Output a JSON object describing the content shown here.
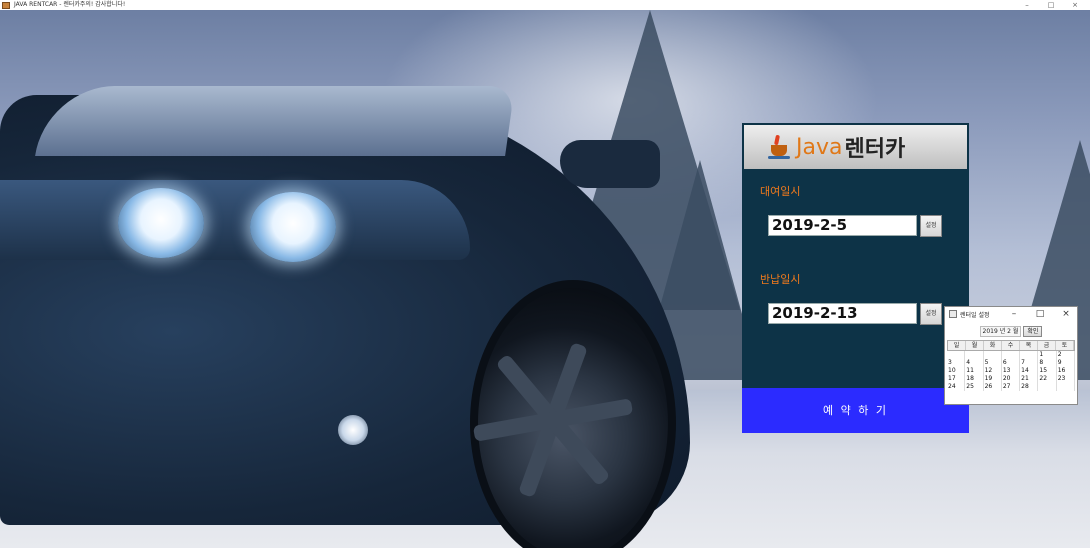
{
  "window": {
    "title": "JAVA RENTCAR - 렌터카주의! 감사합니다!",
    "controls": [
      "–",
      "□",
      "×"
    ]
  },
  "logo": {
    "java_text": "Java",
    "rent_text": "렌터카"
  },
  "form": {
    "rental_label": "대여일시",
    "rental_date": "2019-2-5",
    "rental_pick": "설정",
    "return_label": "반납일시",
    "return_date": "2019-2-13",
    "return_pick": "설정",
    "reserve_button": "예 약 하 기"
  },
  "calendar": {
    "title": "렌터일 설정",
    "controls": [
      "–",
      "□",
      "×"
    ],
    "year_month": "2019 년 2 월",
    "confirm": "확인",
    "weekdays": [
      "일",
      "월",
      "화",
      "수",
      "목",
      "금",
      "토"
    ],
    "days": [
      [
        "",
        "",
        "",
        "",
        "",
        "1",
        "2"
      ],
      [
        "3",
        "4",
        "5",
        "6",
        "7",
        "8",
        "9"
      ],
      [
        "10",
        "11",
        "12",
        "13",
        "14",
        "15",
        "16"
      ],
      [
        "17",
        "18",
        "19",
        "20",
        "21",
        "22",
        "23"
      ],
      [
        "24",
        "25",
        "26",
        "27",
        "28",
        "",
        ""
      ]
    ]
  },
  "colors": {
    "panel_bg": "#0d3347",
    "label": "#f07a1c",
    "reserve_bg": "#2b2bff",
    "java_orange": "#e07818"
  }
}
